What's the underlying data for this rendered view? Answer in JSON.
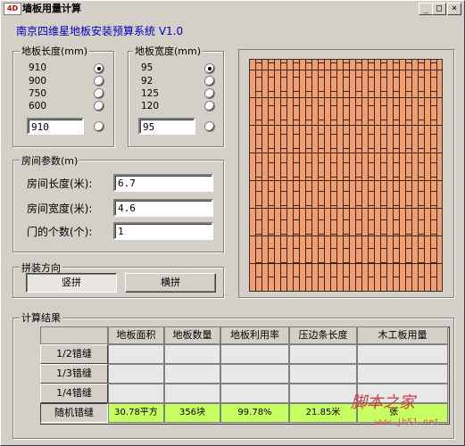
{
  "window": {
    "icon_label": "4D",
    "title": "墙板用量计算",
    "minimize": "_",
    "maximize": "□",
    "close": "×"
  },
  "system_title": "南京四维星地板安装预算系统 V1.0",
  "length_group": {
    "label": "地板长度(mm)",
    "options": [
      "910",
      "900",
      "750",
      "600"
    ],
    "selected_index": 0,
    "custom_value": "910"
  },
  "width_group": {
    "label": "地板宽度(mm)",
    "options": [
      "95",
      "92",
      "125",
      "120"
    ],
    "selected_index": 0,
    "custom_value": "95"
  },
  "room_group": {
    "label": "房间参数(m)",
    "length_label": "房间长度(米):",
    "length_value": "6.7",
    "width_label": "房间宽度(米):",
    "width_value": "4.6",
    "doors_label": "门的个数(个):",
    "doors_value": "1"
  },
  "direction_group": {
    "label": "拼装方向",
    "vertical_button": "竖拼",
    "horizontal_button": "横拼",
    "selected": "vertical"
  },
  "results": {
    "label": "计算结果",
    "columns": [
      "地板面积",
      "地板数量",
      "地板利用率",
      "压边条长度",
      "木工板用量"
    ],
    "rows": [
      {
        "label": "1/2错缝",
        "values": [
          "",
          "",
          "",
          "",
          ""
        ]
      },
      {
        "label": "1/3错缝",
        "values": [
          "",
          "",
          "",
          "",
          ""
        ]
      },
      {
        "label": "1/4错缝",
        "values": [
          "",
          "",
          "",
          "",
          ""
        ]
      },
      {
        "label": "随机错缝",
        "values": [
          "30.78平方",
          "356块",
          "99.78%",
          "21.85米",
          "张"
        ]
      }
    ]
  },
  "watermark": {
    "text": "脚本之家",
    "url": "www.jb51.net"
  }
}
